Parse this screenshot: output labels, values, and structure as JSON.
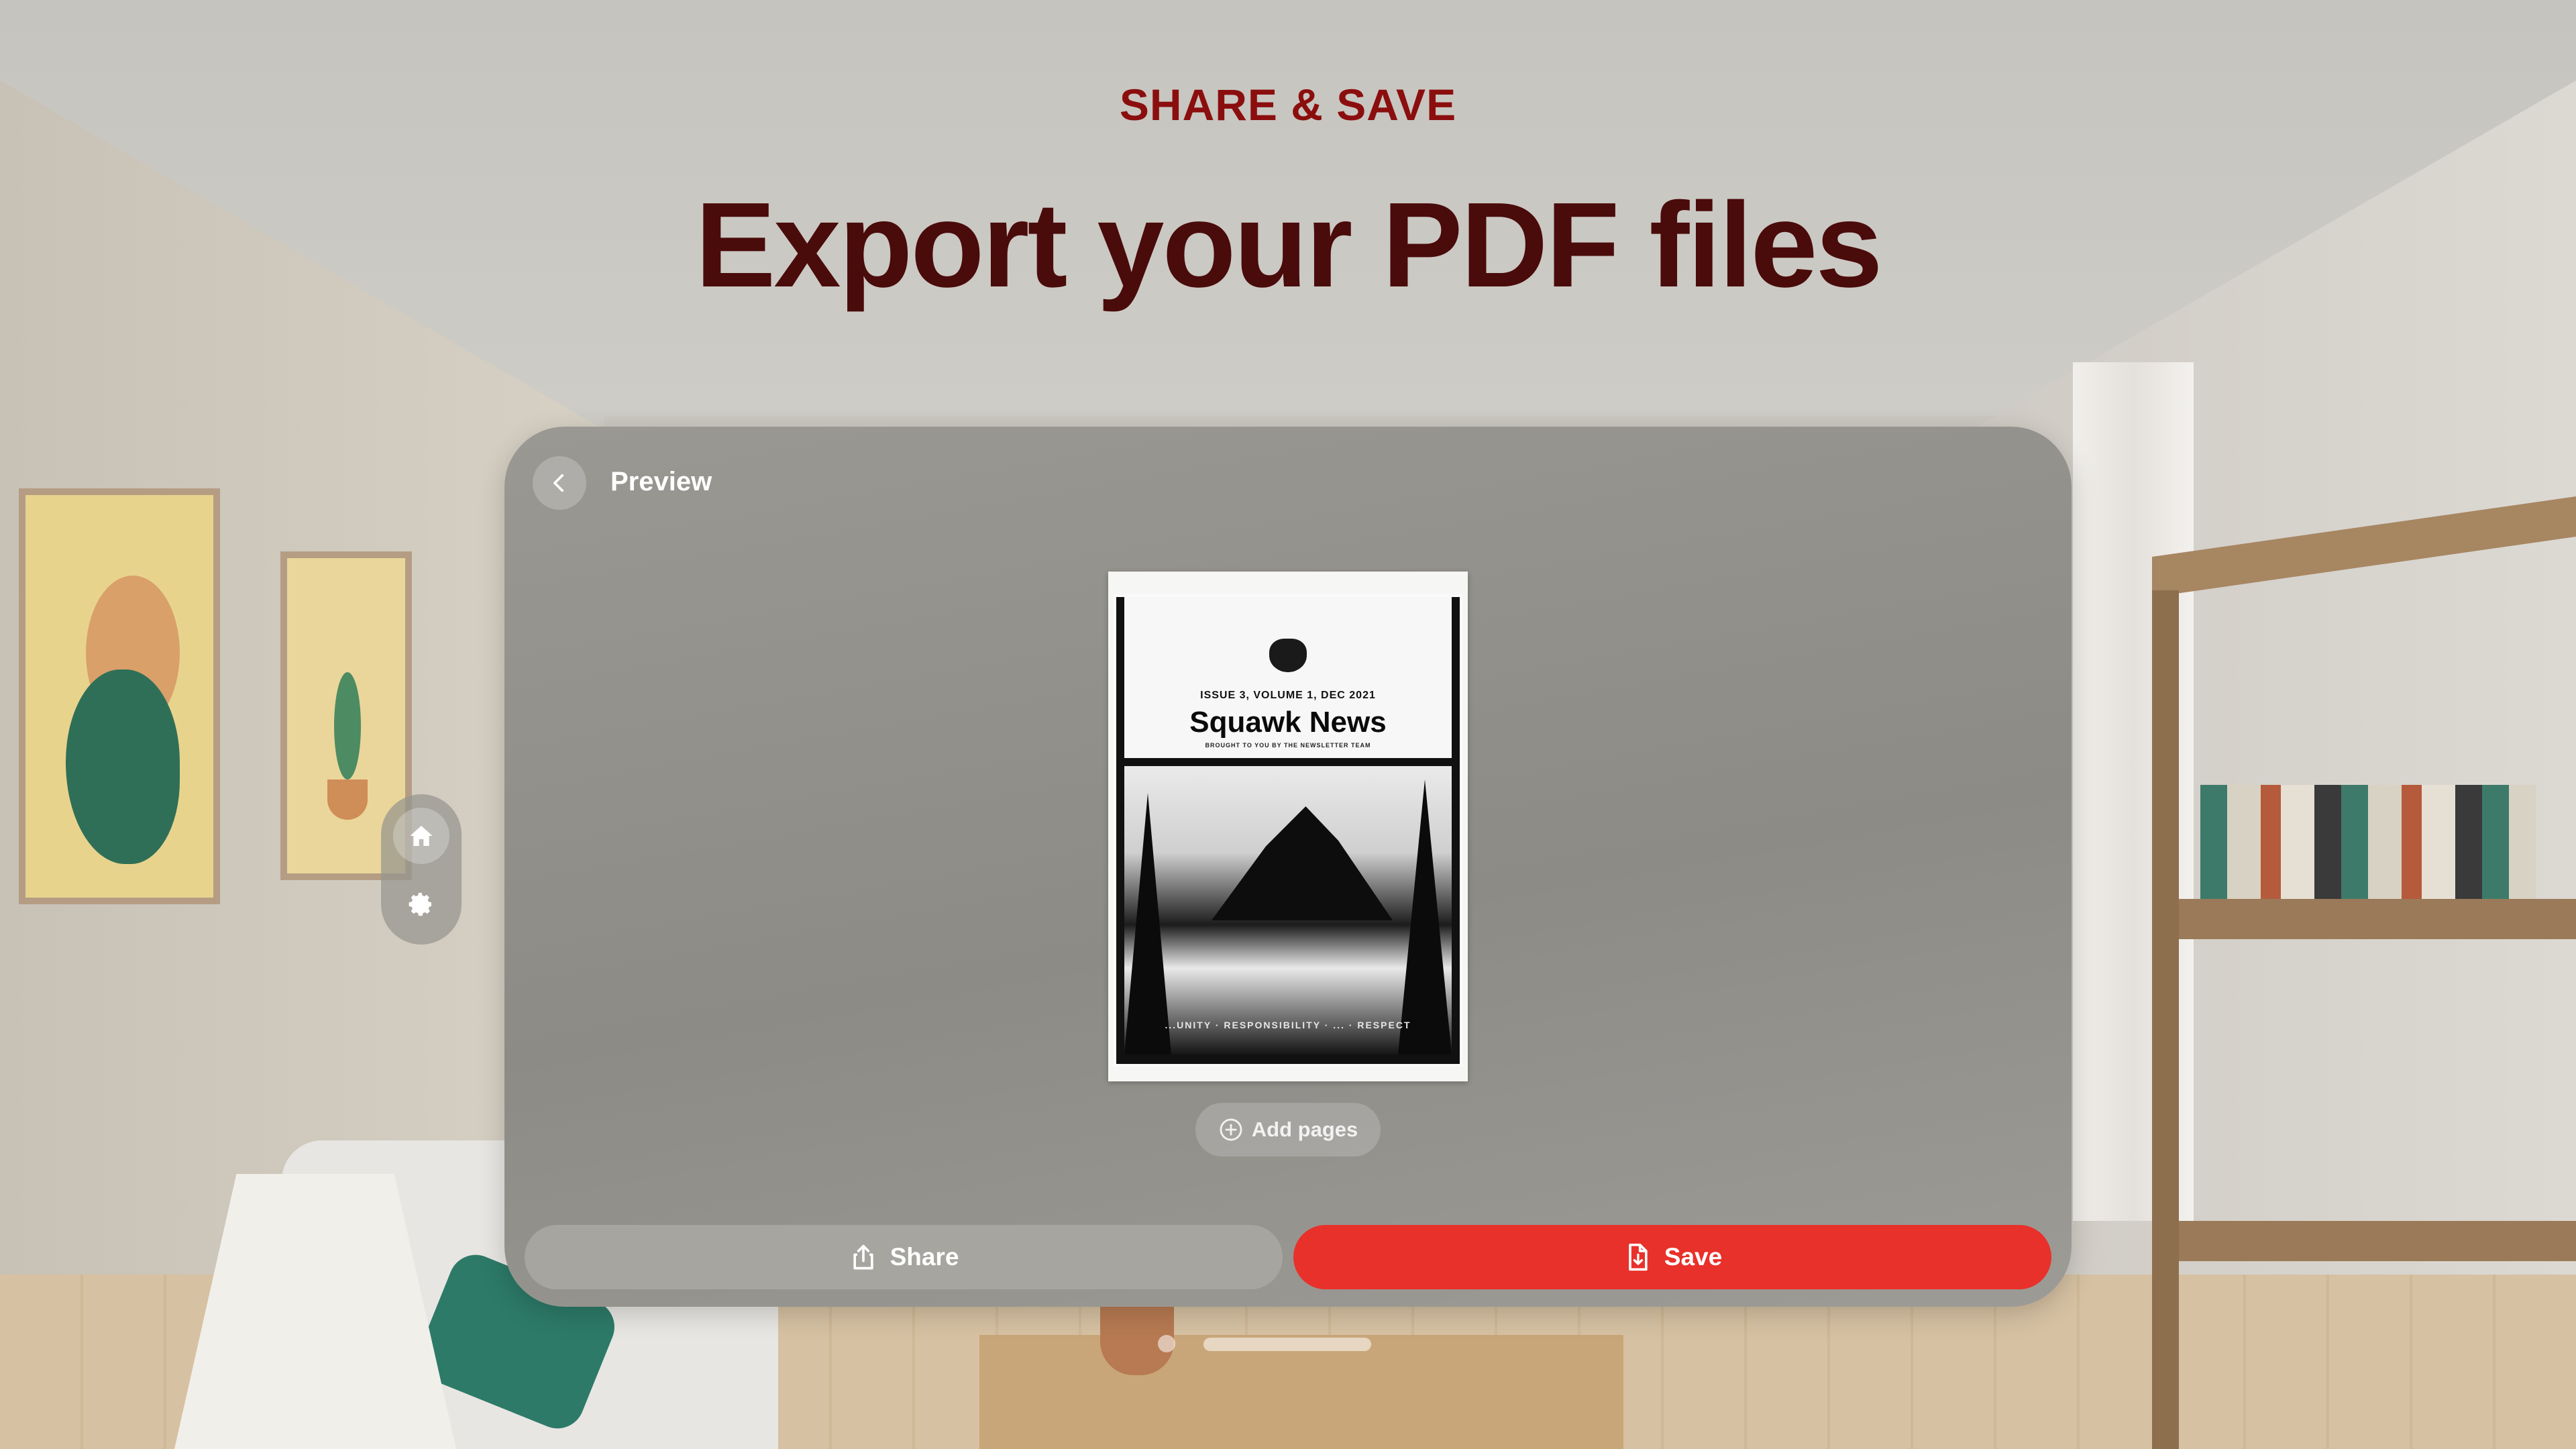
{
  "header": {
    "eyebrow": "SHARE & SAVE",
    "title": "Export your PDF files"
  },
  "window": {
    "title": "Preview",
    "back_icon": "chevron-left-icon"
  },
  "document": {
    "issue": "ISSUE 3, VOLUME 1, DEC 2021",
    "title": "Squawk News",
    "subtitle": "BROUGHT TO YOU BY THE NEWSLETTER TEAM",
    "footer": "...UNITY · RESPONSIBILITY · ... · RESPECT"
  },
  "actions": {
    "add_pages": "Add pages",
    "share": "Share",
    "save": "Save"
  },
  "ornament": {
    "items": [
      "home-icon",
      "gear-icon"
    ]
  },
  "colors": {
    "accent": "#e8312a",
    "eyebrow": "#8b0e0e",
    "headline": "#4a0b0b"
  }
}
